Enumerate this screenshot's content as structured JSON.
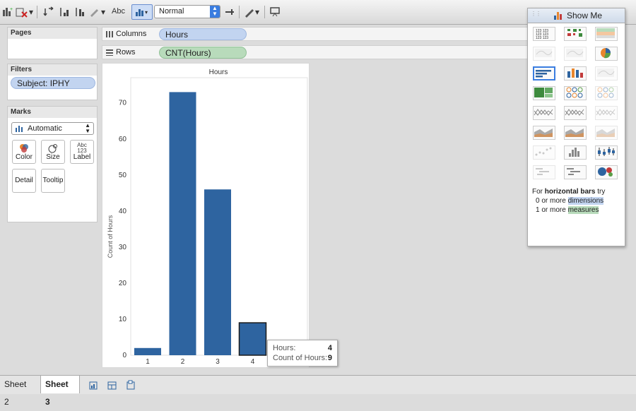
{
  "toolbar": {
    "abc_label": "Abc",
    "fit_value": "Normal",
    "icons": [
      "new-worksheet-icon",
      "clear-sheet-icon",
      "swap-icon",
      "sort-ascending-icon",
      "sort-descending-icon",
      "highlight-icon",
      "labels-icon",
      "show-me-icon",
      "fix-axes-icon",
      "pen-icon",
      "presentation-icon"
    ]
  },
  "pages": {
    "title": "Pages"
  },
  "filters": {
    "title": "Filters",
    "items": [
      "Subject: IPHY"
    ]
  },
  "marks": {
    "title": "Marks",
    "type": "Automatic",
    "buttons": [
      "Color",
      "Size",
      "Label",
      "Detail",
      "Tooltip"
    ]
  },
  "shelves": {
    "columns_label": "Columns",
    "columns_pill": "Hours",
    "rows_label": "Rows",
    "rows_pill": "CNT(Hours)"
  },
  "chart_data": {
    "type": "bar",
    "title": "Hours",
    "ylabel": "Count of Hours",
    "xlabel": "",
    "categories": [
      "1",
      "2",
      "3",
      "4"
    ],
    "values": [
      2,
      73,
      46,
      9
    ],
    "yticks": [
      0,
      10,
      20,
      30,
      40,
      50,
      60,
      70
    ],
    "ylim": [
      0,
      77
    ],
    "bar_color": "#2e64a0",
    "highlighted_category": "4",
    "grid": false
  },
  "tooltip": {
    "row1_label": "Hours:",
    "row1_value": "4",
    "row2_label": "Count of Hours:",
    "row2_value": "9"
  },
  "showme": {
    "title": "Show Me",
    "hint_prefix": "For ",
    "hint_bold": "horizontal bars",
    "hint_suffix": " try",
    "req1_prefix": "0 or more ",
    "req1_key": "dimensions",
    "req2_prefix": "1 or more ",
    "req2_key": "measures"
  },
  "tabs": {
    "sheet2": "Sheet 2",
    "sheet3": "Sheet 3"
  },
  "colors": {
    "accent": "#3a7de0",
    "bar": "#2e64a0"
  }
}
